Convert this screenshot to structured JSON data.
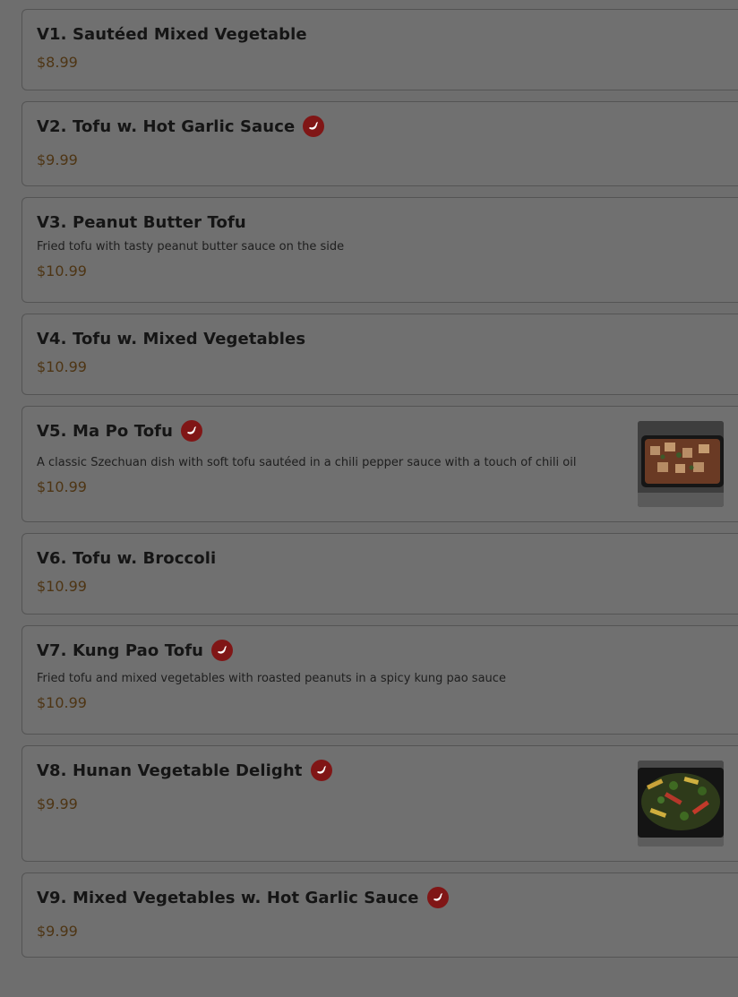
{
  "colors": {
    "overlay_background": "#6e6e6e",
    "card_background": "#707070",
    "price": "#4e3514",
    "spicy_badge": "#801616"
  },
  "menu": {
    "items": [
      {
        "name": "V1. Sautéed Mixed Vegetable",
        "description": "",
        "price": "$8.99",
        "spicy": false,
        "image": false
      },
      {
        "name": "V2. Tofu w. Hot Garlic Sauce",
        "description": "",
        "price": "$9.99",
        "spicy": true,
        "image": false
      },
      {
        "name": "V3. Peanut Butter Tofu",
        "description": "Fried tofu with tasty peanut butter sauce on the side",
        "price": "$10.99",
        "spicy": false,
        "image": false
      },
      {
        "name": "V4. Tofu w. Mixed Vegetables",
        "description": "",
        "price": "$10.99",
        "spicy": false,
        "image": false
      },
      {
        "name": "V5. Ma Po Tofu",
        "description": "A classic Szechuan dish with soft tofu sautéed in a chili pepper sauce with a touch of chili oil",
        "price": "$10.99",
        "spicy": true,
        "image": true
      },
      {
        "name": "V6. Tofu w. Broccoli",
        "description": "",
        "price": "$10.99",
        "spicy": false,
        "image": false
      },
      {
        "name": "V7. Kung Pao Tofu",
        "description": "Fried tofu and mixed vegetables with roasted peanuts in a spicy kung pao sauce",
        "price": "$10.99",
        "spicy": true,
        "image": false
      },
      {
        "name": "V8. Hunan Vegetable Delight",
        "description": "",
        "price": "$9.99",
        "spicy": true,
        "image": true
      },
      {
        "name": "V9. Mixed Vegetables w. Hot Garlic Sauce",
        "description": "",
        "price": "$9.99",
        "spicy": true,
        "image": false
      }
    ]
  }
}
